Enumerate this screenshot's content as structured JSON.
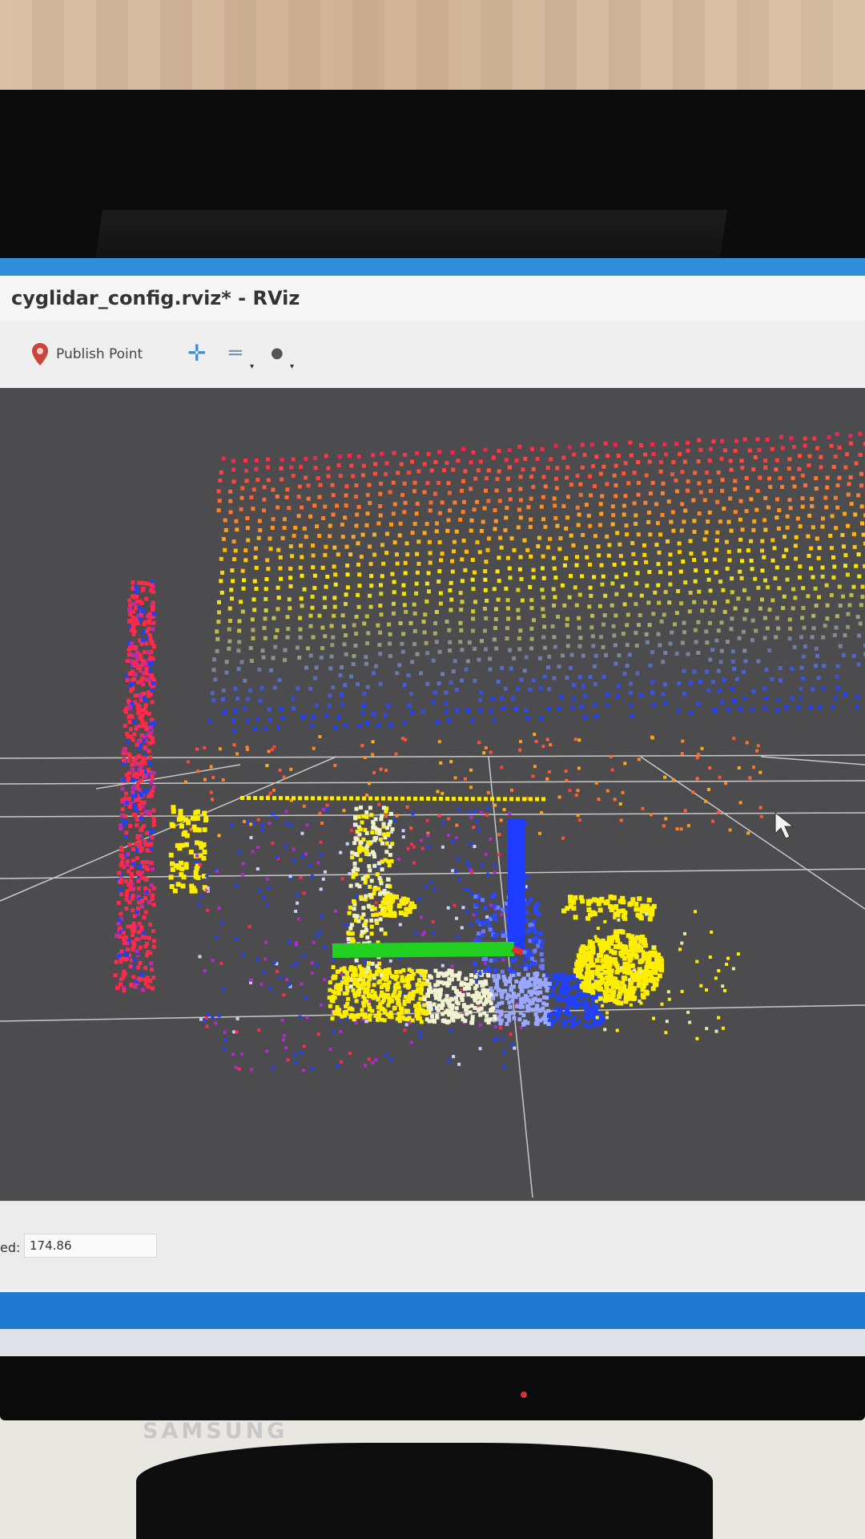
{
  "window": {
    "title": "cyglidar_config.rviz* - RViz"
  },
  "toolbar": {
    "publish_point_label": "Publish Point",
    "icons": [
      "map-pin-icon",
      "plus-icon",
      "minus-icon",
      "camera-icon"
    ]
  },
  "status": {
    "field_label": "ed:",
    "field_value": "174.86"
  },
  "monitor": {
    "brand": "SAMSUNG"
  },
  "colors": {
    "title_accent": "#2f8fdc",
    "taskbar": "#1f78d1",
    "viewport_bg": "#4c4c4e",
    "grid": "#c8c8c8",
    "axis_x": "#e03030",
    "axis_y": "#22d022",
    "axis_z": "#1e3cff",
    "points_high": "#ff2a4a",
    "points_mid": "#ffee00",
    "points_low": "#2040ff"
  }
}
